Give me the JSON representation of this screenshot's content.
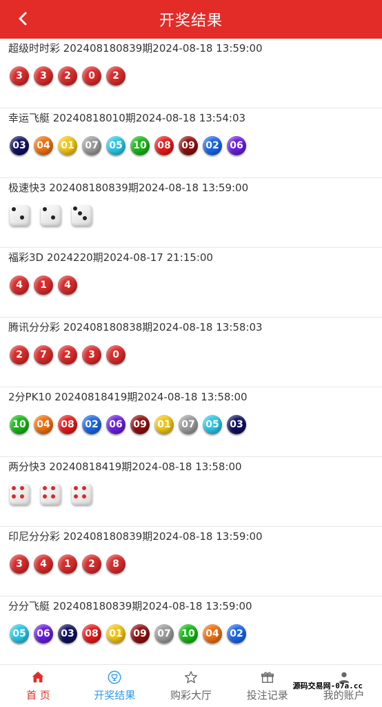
{
  "header": {
    "title": "开奖结果"
  },
  "results": [
    {
      "name": "超级时时彩",
      "meta": "超级时时彩 202408180839期2024-08-18 13:59:00",
      "kind": "digits",
      "balls": [
        {
          "text": "3"
        },
        {
          "text": "3"
        },
        {
          "text": "2"
        },
        {
          "text": "0"
        },
        {
          "text": "2"
        }
      ]
    },
    {
      "name": "幸运飞艇",
      "meta": "幸运飞艇 20240818010期2024-08-18 13:54:03",
      "kind": "pk",
      "balls": [
        {
          "text": "03",
          "color": "#101060"
        },
        {
          "text": "04",
          "color": "#f0700f"
        },
        {
          "text": "01",
          "color": "#f2c40f"
        },
        {
          "text": "07",
          "color": "#9a9a9a"
        },
        {
          "text": "05",
          "color": "#27c6e8"
        },
        {
          "text": "10",
          "color": "#16b816"
        },
        {
          "text": "08",
          "color": "#e61a1a"
        },
        {
          "text": "09",
          "color": "#8e0f0f"
        },
        {
          "text": "02",
          "color": "#1a67e8"
        },
        {
          "text": "06",
          "color": "#6a1ee0"
        }
      ]
    },
    {
      "name": "极速快3",
      "meta": "极速快3 202408180839期2024-08-18 13:59:00",
      "kind": "dice",
      "pip_color": "#222222",
      "dice": [
        2,
        2,
        3
      ]
    },
    {
      "name": "福彩3D",
      "meta": "福彩3D 2024220期2024-08-17 21:15:00",
      "kind": "digits",
      "balls": [
        {
          "text": "4"
        },
        {
          "text": "1"
        },
        {
          "text": "4"
        }
      ]
    },
    {
      "name": "腾讯分分彩",
      "meta": "腾讯分分彩 202408180838期2024-08-18 13:58:03",
      "kind": "digits",
      "balls": [
        {
          "text": "2"
        },
        {
          "text": "7"
        },
        {
          "text": "2"
        },
        {
          "text": "3"
        },
        {
          "text": "0"
        }
      ]
    },
    {
      "name": "2分PK10",
      "meta": "2分PK10 20240818419期2024-08-18 13:58:00",
      "kind": "pk",
      "balls": [
        {
          "text": "10",
          "color": "#16b816"
        },
        {
          "text": "04",
          "color": "#f0700f"
        },
        {
          "text": "08",
          "color": "#e61a1a"
        },
        {
          "text": "02",
          "color": "#1a67e8"
        },
        {
          "text": "06",
          "color": "#6a1ee0"
        },
        {
          "text": "09",
          "color": "#8e0f0f"
        },
        {
          "text": "01",
          "color": "#f2c40f"
        },
        {
          "text": "07",
          "color": "#9a9a9a"
        },
        {
          "text": "05",
          "color": "#27c6e8"
        },
        {
          "text": "03",
          "color": "#101060"
        }
      ]
    },
    {
      "name": "两分快3",
      "meta": "两分快3 20240818419期2024-08-18 13:58:00",
      "kind": "dice",
      "pip_color": "#d62b2b",
      "dice": [
        4,
        4,
        4
      ]
    },
    {
      "name": "印尼分分彩",
      "meta": "印尼分分彩 202408180839期2024-08-18 13:59:00",
      "kind": "digits",
      "balls": [
        {
          "text": "3"
        },
        {
          "text": "4"
        },
        {
          "text": "1"
        },
        {
          "text": "2"
        },
        {
          "text": "8"
        }
      ]
    },
    {
      "name": "分分飞艇",
      "meta": "分分飞艇 202408180839期2024-08-18 13:59:00",
      "kind": "pk",
      "balls": [
        {
          "text": "05",
          "color": "#27c6e8"
        },
        {
          "text": "06",
          "color": "#6a1ee0"
        },
        {
          "text": "03",
          "color": "#101060"
        },
        {
          "text": "08",
          "color": "#e61a1a"
        },
        {
          "text": "01",
          "color": "#f2c40f"
        },
        {
          "text": "09",
          "color": "#8e0f0f"
        },
        {
          "text": "07",
          "color": "#9a9a9a"
        },
        {
          "text": "10",
          "color": "#16b816"
        },
        {
          "text": "04",
          "color": "#f0700f"
        },
        {
          "text": "02",
          "color": "#1a67e8"
        }
      ]
    }
  ],
  "tabbar": {
    "home": "首 页",
    "results": "开奖结果",
    "lobby": "购彩大厅",
    "records": "投注记录",
    "account": "我的账户"
  },
  "watermark": "源码交易网-07a.cc",
  "colors": {
    "brand_red": "#e32c28",
    "active_blue": "#2e9cf0",
    "digit_ball": "#d92b2b"
  }
}
